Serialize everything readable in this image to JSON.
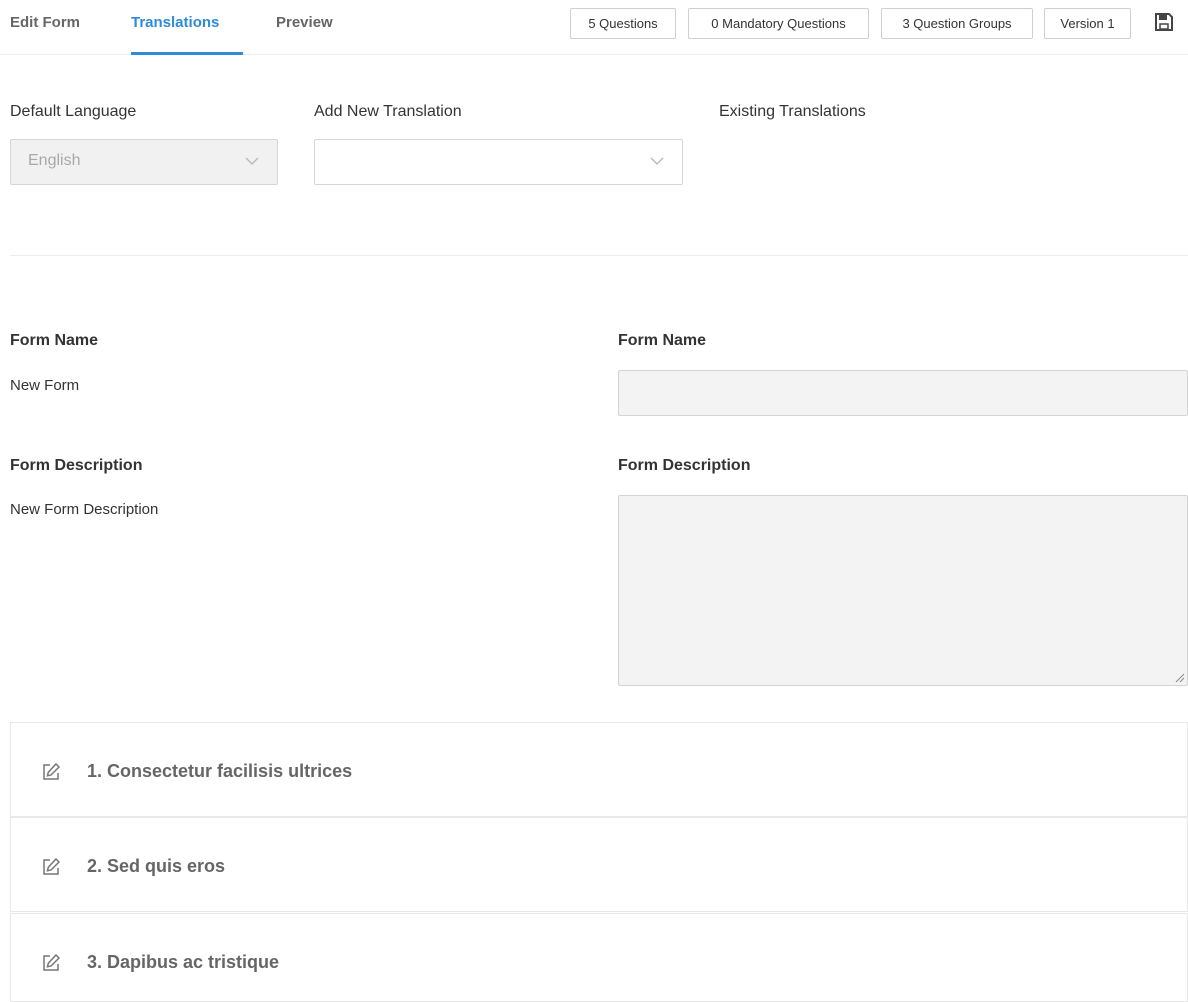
{
  "tabs": {
    "edit_form": "Edit Form",
    "translations": "Translations",
    "preview": "Preview",
    "active": "Translations"
  },
  "badges": {
    "questions": "5 Questions",
    "mandatory": "0 Mandatory Questions",
    "groups": "3 Question Groups",
    "version": "Version 1"
  },
  "toolbar": {
    "save_icon": "floppy-disk-icon"
  },
  "languages": {
    "default_label": "Default Language",
    "default_value": "English",
    "add_label": "Add New Translation",
    "add_value": "",
    "existing_label": "Existing Translations"
  },
  "form": {
    "name_label": "Form Name",
    "name_value": "New Form",
    "translated_name_label": "Form Name",
    "translated_name_value": "",
    "description_label": "Form Description",
    "description_value": "New Form Description",
    "translated_description_label": "Form Description",
    "translated_description_value": ""
  },
  "question_groups": [
    {
      "title": "1. Consectetur facilisis ultrices",
      "icon": "edit-icon"
    },
    {
      "title": "2. Sed quis eros",
      "icon": "edit-icon"
    },
    {
      "title": "3. Dapibus ac tristique",
      "icon": "edit-icon"
    }
  ],
  "colors": {
    "accent": "#2f8ad8",
    "tab_inactive": "#666666",
    "input_background": "#f3f3f3",
    "border": "#d6d6d6"
  }
}
